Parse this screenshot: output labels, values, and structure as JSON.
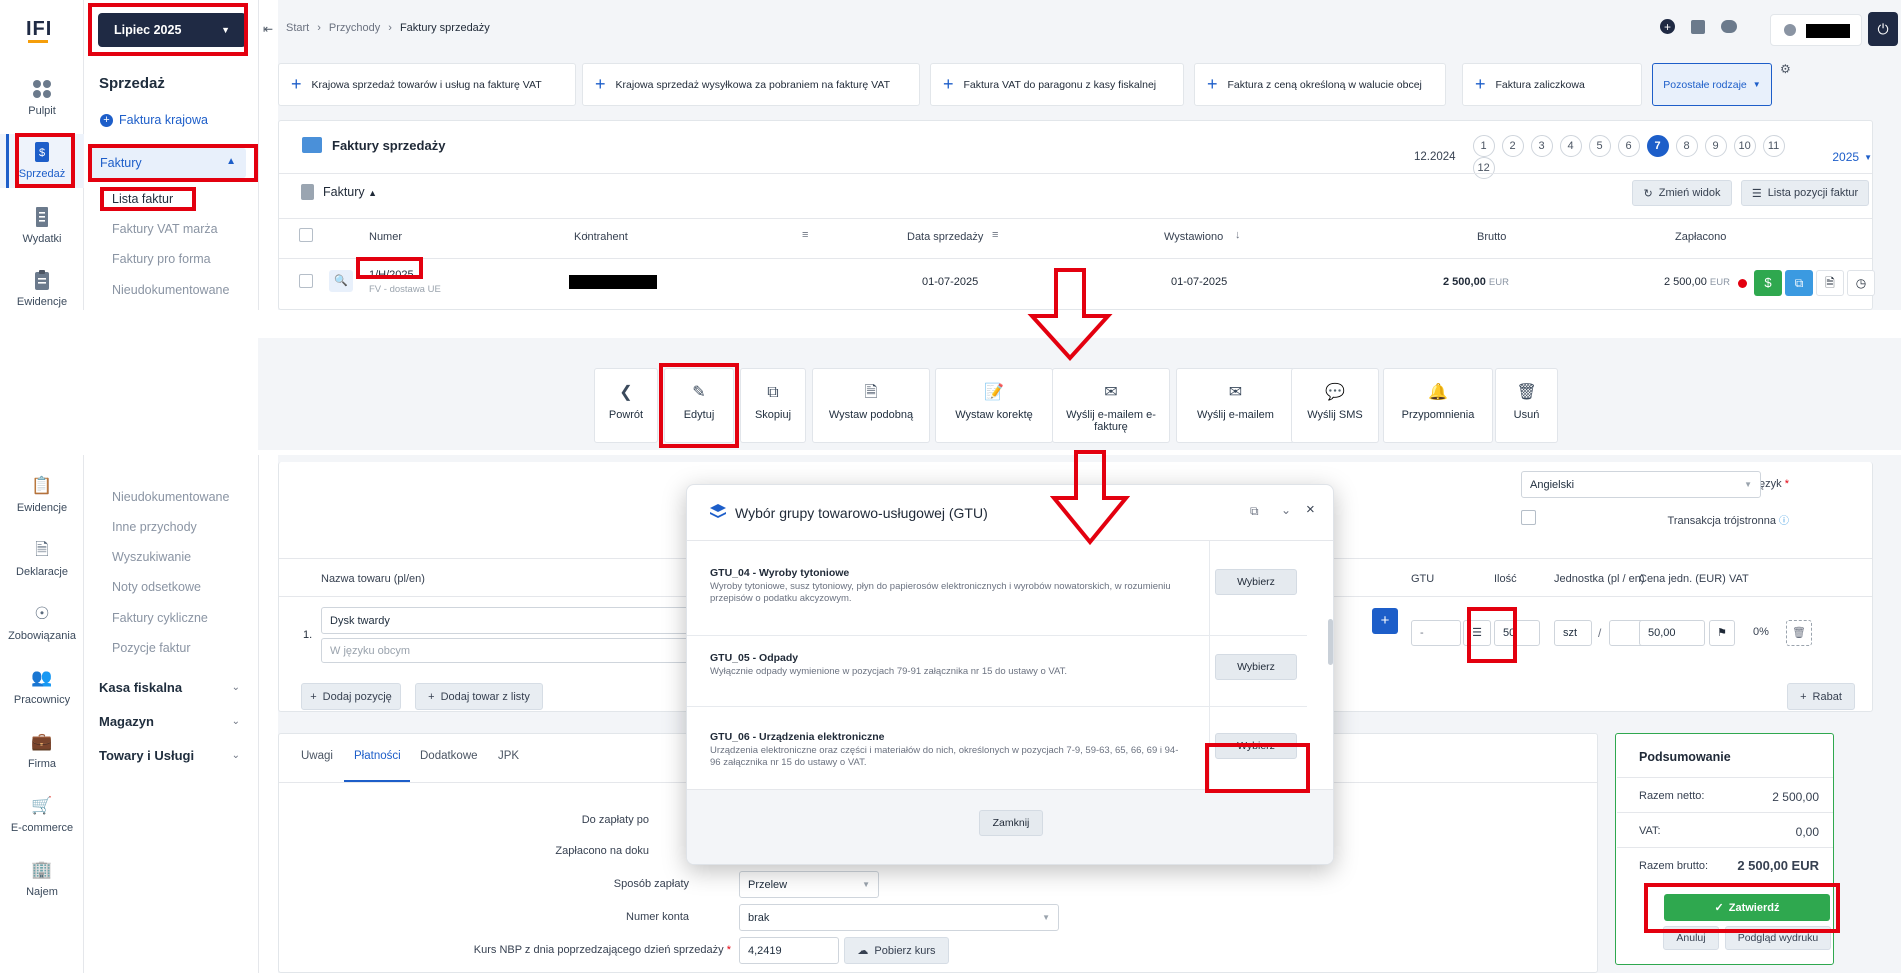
{
  "logo": "IFI",
  "month_selector": "Lipiec 2025",
  "rail": [
    {
      "label": "Pulpit",
      "icon": "grid-icon"
    },
    {
      "label": "Sprzedaż",
      "icon": "invoice-dollar-icon"
    },
    {
      "label": "Wydatki",
      "icon": "receipt-icon"
    },
    {
      "label": "Ewidencje",
      "icon": "clipboard-icon"
    }
  ],
  "rail2": [
    {
      "label": "Ewidencje",
      "icon": "clipboard-icon"
    },
    {
      "label": "Deklaracje",
      "icon": "document-icon"
    },
    {
      "label": "Zobowiązania",
      "icon": "coins-icon"
    },
    {
      "label": "Pracownicy",
      "icon": "people-icon"
    },
    {
      "label": "Firma",
      "icon": "briefcase-icon"
    },
    {
      "label": "E-commerce",
      "icon": "cart-icon"
    },
    {
      "label": "Najem",
      "icon": "building-icon"
    }
  ],
  "menu": {
    "title": "Sprzedaż",
    "add_invoice": "Faktura krajowa",
    "section": "Faktury",
    "items": [
      "Lista faktur",
      "Faktury VAT marża",
      "Faktury pro forma",
      "Nieudokumentowane"
    ]
  },
  "menu2": {
    "items": [
      "Nieudokumentowane",
      "Inne przychody",
      "Wyszukiwanie",
      "Noty odsetkowe",
      "Faktury cykliczne",
      "Pozycje faktur"
    ],
    "groups": [
      "Kasa fiskalna",
      "Magazyn",
      "Towary i Usługi"
    ]
  },
  "breadcrumb": [
    "Start",
    "Przychody",
    "Faktury sprzedaży"
  ],
  "quick_add": [
    "Krajowa sprzedaż towarów i usług na fakturę VAT",
    "Krajowa sprzedaż wysyłkowa za pobraniem na fakturę VAT",
    "Faktura VAT do paragonu z kasy fiskalnej",
    "Faktura z ceną określoną w walucie obcej",
    "Faktura zaliczkowa"
  ],
  "other_types": "Pozostałe rodzaje",
  "list": {
    "title": "Faktury sprzedaży",
    "prev_period": "12.2024",
    "months": [
      "1",
      "2",
      "3",
      "4",
      "5",
      "6",
      "7",
      "8",
      "9",
      "10",
      "11",
      "12"
    ],
    "active_month": "7",
    "year": "2025",
    "sub_title": "Faktury",
    "change_view": "Zmień widok",
    "positions_list": "Lista pozycji faktur"
  },
  "table": {
    "headers": {
      "numer": "Numer",
      "kontrahent": "Kontrahent",
      "data": "Data sprzedaży",
      "wystawiono": "Wystawiono",
      "brutto": "Brutto",
      "zaplacono": "Zapłacono"
    },
    "row": {
      "numer": "1/H/2025",
      "typ": "FV - dostawa UE",
      "data": "01-07-2025",
      "wystawiono": "01-07-2025",
      "brutto": "2 500,00",
      "brutto_cur": "EUR",
      "zaplacono": "2 500,00",
      "zaplacono_cur": "EUR"
    }
  },
  "actions": [
    {
      "label": "Powrót",
      "icon": "chevron-left-icon"
    },
    {
      "label": "Edytuj",
      "icon": "edit-icon"
    },
    {
      "label": "Skopiuj",
      "icon": "copy-icon"
    },
    {
      "label": "Wystaw podobną",
      "icon": "file-plus-icon"
    },
    {
      "label": "Wystaw korektę",
      "icon": "file-edit-icon"
    },
    {
      "label": "Wyślij e-mailem e-fakturę",
      "icon": "envelope-icon"
    },
    {
      "label": "Wyślij e-mailem",
      "icon": "envelope-icon"
    },
    {
      "label": "Wyślij SMS",
      "icon": "sms-icon"
    },
    {
      "label": "Przypomnienia",
      "icon": "bell-icon"
    },
    {
      "label": "Usuń",
      "icon": "trash-icon"
    }
  ],
  "form": {
    "language_label": "Język",
    "language_value": "Angielski",
    "triangular_label": "Transakcja trójstronna",
    "items_headers": {
      "name": "Nazwa towaru (pl/en)",
      "gtu": "GTU",
      "qty": "Ilość",
      "unit": "Jednostka (pl / en)",
      "price": "Cena jedn. (EUR)",
      "vat": "VAT"
    },
    "item": {
      "index": "1.",
      "name": "Dysk twardy",
      "name_foreign_placeholder": "W języku obcym",
      "gtu": "-",
      "qty": "50",
      "unit": "szt",
      "price": "50,00",
      "vat": "0%"
    },
    "add_position": "Dodaj pozycję",
    "add_from_list": "Dodaj towar z listy",
    "discount": "Rabat",
    "tabs": [
      "Uwagi",
      "Płatności",
      "Dodatkowe",
      "JPK"
    ],
    "active_tab": "Płatności",
    "labels": {
      "to_pay": "Do zapłaty po",
      "paid_on_doc": "Zapłacono na doku",
      "payment_method": "Sposób zapłaty",
      "account": "Numer konta",
      "rate": "Kurs NBP z dnia poprzedzającego dzień sprzedaży"
    },
    "values": {
      "payment_method": "Przelew",
      "account": "brak",
      "rate": "4,2419",
      "fetch_rate": "Pobierz kurs"
    }
  },
  "summary": {
    "title": "Podsumowanie",
    "net_label": "Razem netto:",
    "net": "2 500,00",
    "vat_label": "VAT:",
    "vat": "0,00",
    "gross_label": "Razem brutto:",
    "gross": "2 500,00 EUR",
    "confirm": "Zatwierdź",
    "cancel": "Anuluj",
    "preview": "Podgląd wydruku"
  },
  "modal": {
    "title": "Wybór grupy towarowo-usługowej (GTU)",
    "items": [
      {
        "code": "GTU_04",
        "name": "Wyroby tytoniowe",
        "desc": "Wyroby tytoniowe, susz tytoniowy, płyn do papierosów elektronicznych i wyrobów nowatorskich, w rozumieniu przepisów o podatku akcyzowym."
      },
      {
        "code": "GTU_05",
        "name": "Odpady",
        "desc": "Wyłącznie odpady wymienione w pozycjach 79-91 załącznika nr 15 do ustawy o VAT."
      },
      {
        "code": "GTU_06",
        "name": "Urządzenia elektroniczne",
        "desc": "Urządzenia elektroniczne oraz części i materiałów do nich, określonych w pozycjach 7-9, 59-63, 65, 66, 69 i 94-96 załącznika nr 15 do ustawy o VAT."
      }
    ],
    "select": "Wybierz",
    "close": "Zamknij"
  },
  "colors": {
    "accent": "#1d5ec9",
    "highlight": "#e3000f",
    "confirm": "#2fa84f",
    "dark": "#1f2a44"
  }
}
